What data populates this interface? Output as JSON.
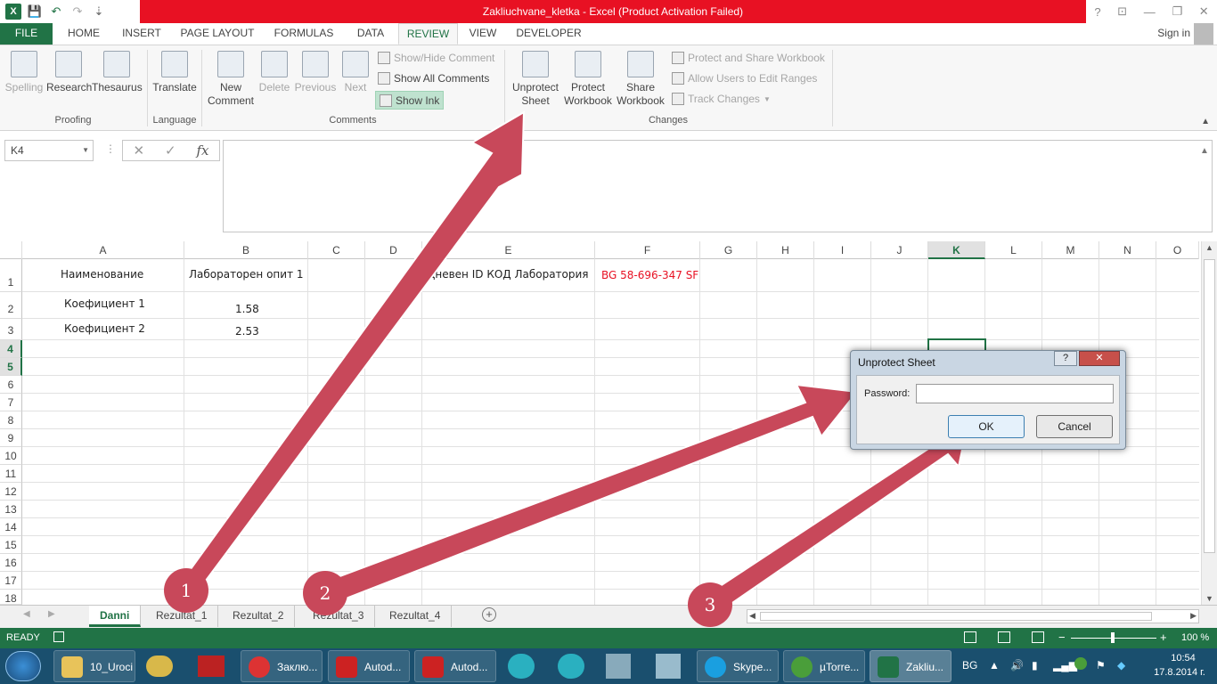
{
  "window": {
    "title": "Zakliuchvane_kletka -  Excel (Product Activation Failed)",
    "help": "?",
    "restore_ribbon": "⊡",
    "minimize": "—",
    "maximize": "❐",
    "close": "✕"
  },
  "qat": {
    "logo": "X",
    "save": "💾",
    "undo": "↶",
    "redo": "↷",
    "customize": "⇣"
  },
  "tabs": [
    "FILE",
    "HOME",
    "INSERT",
    "PAGE LAYOUT",
    "FORMULAS",
    "DATA",
    "REVIEW",
    "VIEW",
    "DEVELOPER"
  ],
  "signin": "Sign in",
  "ribbon": {
    "proofing": {
      "spelling": "Spelling",
      "research": "Research",
      "thesaurus": "Thesaurus",
      "label": "Proofing"
    },
    "language": {
      "translate": "Translate",
      "label": "Language"
    },
    "comments": {
      "new": "New",
      "new2": "Comment",
      "delete": "Delete",
      "previous": "Previous",
      "next": "Next",
      "show_hide": "Show/Hide Comment",
      "show_all": "Show All Comments",
      "show_ink": "Show Ink",
      "label": "Comments"
    },
    "changes": {
      "unprotect1": "Unprotect",
      "unprotect2": "Sheet",
      "protect_wb1": "Protect",
      "protect_wb2": "Workbook",
      "share1": "Share",
      "share2": "Workbook",
      "protect_share": "Protect and Share Workbook",
      "allow_edit": "Allow Users to Edit Ranges",
      "track": "Track Changes",
      "label": "Changes"
    }
  },
  "namebox": "K4",
  "fx": {
    "cancel": "✕",
    "enter": "✓",
    "fx": "fx"
  },
  "columns": [
    "A",
    "B",
    "C",
    "D",
    "E",
    "F",
    "G",
    "H",
    "I",
    "J",
    "K",
    "L",
    "M",
    "N",
    "O"
  ],
  "rows": [
    "1",
    "2",
    "3",
    "4",
    "5",
    "6",
    "7",
    "8",
    "9",
    "10",
    "11",
    "12",
    "13",
    "14",
    "15",
    "16",
    "17",
    "18"
  ],
  "cells": {
    "a1": "Наименование",
    "b1": "Лабораторен опит 1",
    "e1": "Дневен ID КОД Лаборатория",
    "f1": "BG 58-696-347 SF",
    "a2": "Коефициент 1",
    "b2": "1.58",
    "a3": "Коефициент 2",
    "b3": "2.53"
  },
  "sheets": [
    "Danni",
    "Rezultat_1",
    "Rezultat_2",
    "Rezultat_3",
    "Rezultat_4"
  ],
  "add_sheet": "+",
  "status": {
    "ready": "READY",
    "zoom": "100 %",
    "minus": "−",
    "plus": "+"
  },
  "dialog": {
    "title": "Unprotect Sheet",
    "help": "?",
    "close": "✕",
    "password_label": "Password:",
    "password": "",
    "ok": "OK",
    "cancel": "Cancel"
  },
  "bubbles": [
    "1",
    "2",
    "3"
  ],
  "taskbar": {
    "items": [
      "10_Uroci",
      "Заклю...",
      "Autod...",
      "Autod...",
      "Skype...",
      "µTorre...",
      "Zakliu..."
    ],
    "lang": "BG",
    "time": "10:54",
    "date": "17.8.2014 г."
  },
  "colors": {
    "excel_green": "#217346",
    "red_bar": "#e81123",
    "arrow": "#c8485a",
    "f1_red": "#e81123"
  }
}
